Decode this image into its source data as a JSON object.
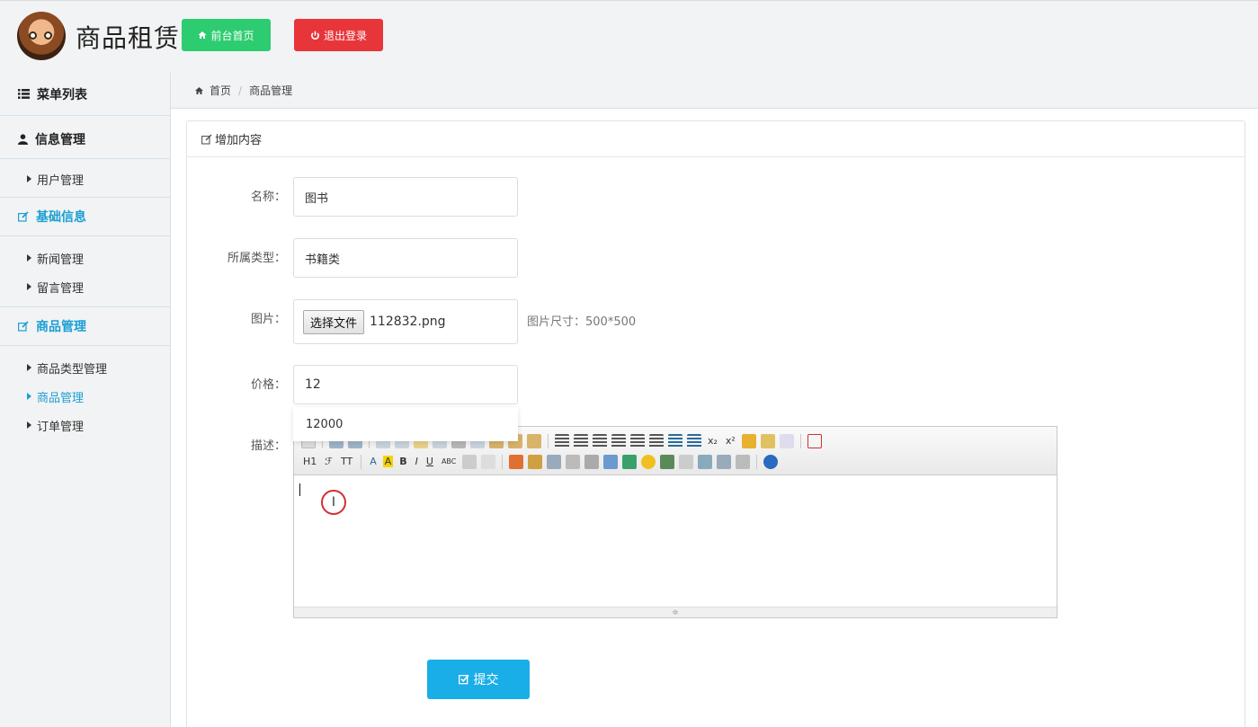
{
  "header": {
    "title": "商品租赁",
    "front_home_label": "前台首页",
    "logout_label": "退出登录"
  },
  "breadcrumb": {
    "home": "首页",
    "current": "商品管理"
  },
  "sidebar": {
    "menu_title": "菜单列表",
    "groups": [
      {
        "title": "信息管理",
        "items": [
          "用户管理"
        ]
      },
      {
        "title": "基础信息",
        "items": [
          "新闻管理",
          "留言管理"
        ]
      },
      {
        "title": "商品管理",
        "items": [
          "商品类型管理",
          "商品管理",
          "订单管理"
        ],
        "active_item": "商品管理"
      }
    ]
  },
  "panel": {
    "heading": "增加内容"
  },
  "form": {
    "name_label": "名称：",
    "name_value": "图书",
    "type_label": "所属类型：",
    "type_value": "书籍类",
    "image_label": "图片：",
    "file_button": "选择文件",
    "file_name": "112832.png",
    "image_hint": "图片尺寸：500*500",
    "price_label": "价格：",
    "price_value": "12",
    "price_suggestion": "12000",
    "desc_label": "描述：",
    "submit_label": "提交"
  },
  "editor": {
    "toolbar_row2_text": [
      "H1",
      "ℱ",
      "TT",
      "A",
      "A",
      "B",
      "I",
      "U",
      "ABC"
    ]
  },
  "colors": {
    "green_button": "#2ecc71",
    "red_button": "#e8353a",
    "accent_blue": "#1a9fd4",
    "submit_blue": "#1aaee8"
  }
}
